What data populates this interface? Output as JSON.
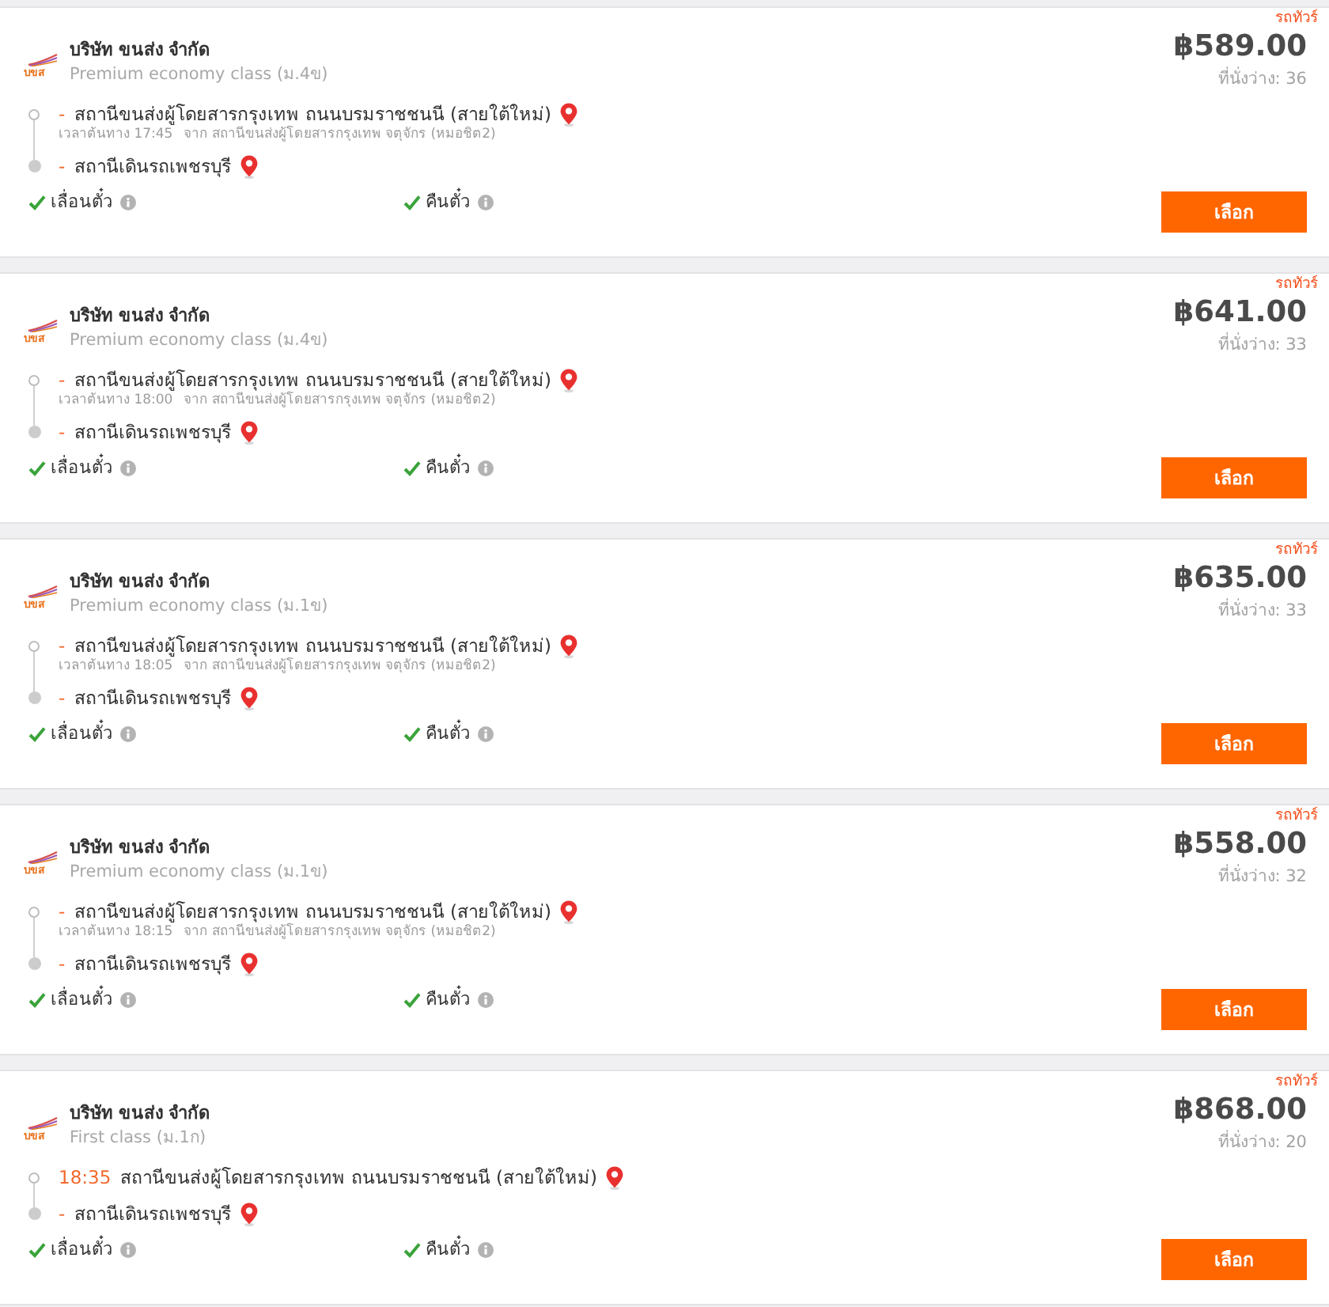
{
  "trips": [
    {
      "tag": "รถทัวร์",
      "logo_text": "บขส",
      "company": "บริษัท ขนส่ง จำกัด",
      "service_class": "Premium economy class (ม.4ข)",
      "price": "฿589.00",
      "seats": "ที่นั่งว่าง: 36",
      "departure": {
        "marker": "-",
        "station": "สถานีขนส่งผู้โดยสารกรุงเทพ ถนนบรมราชชนนี (สายใต้ใหม่)"
      },
      "origin_note": {
        "time": "เวลาต้นทาง 17:45",
        "from": "จาก สถานีขนส่งผู้โดยสารกรุงเทพ จตุจักร (หมอชิต2)"
      },
      "arrival": {
        "marker": "-",
        "station": "สถานีเดินรถเพชรบุรี"
      },
      "policies": [
        {
          "label": "เลื่อนตั๋ว",
          "allowed": true
        },
        {
          "label": "คืนตั๋ว",
          "allowed": true
        }
      ],
      "button": "เลือก"
    },
    {
      "tag": "รถทัวร์",
      "logo_text": "บขส",
      "company": "บริษัท ขนส่ง จำกัด",
      "service_class": "Premium economy class (ม.4ข)",
      "price": "฿641.00",
      "seats": "ที่นั่งว่าง: 33",
      "departure": {
        "marker": "-",
        "station": "สถานีขนส่งผู้โดยสารกรุงเทพ ถนนบรมราชชนนี (สายใต้ใหม่)"
      },
      "origin_note": {
        "time": "เวลาต้นทาง 18:00",
        "from": "จาก สถานีขนส่งผู้โดยสารกรุงเทพ จตุจักร (หมอชิต2)"
      },
      "arrival": {
        "marker": "-",
        "station": "สถานีเดินรถเพชรบุรี"
      },
      "policies": [
        {
          "label": "เลื่อนตั๋ว",
          "allowed": true
        },
        {
          "label": "คืนตั๋ว",
          "allowed": true
        }
      ],
      "button": "เลือก"
    },
    {
      "tag": "รถทัวร์",
      "logo_text": "บขส",
      "company": "บริษัท ขนส่ง จำกัด",
      "service_class": "Premium economy class (ม.1ข)",
      "price": "฿635.00",
      "seats": "ที่นั่งว่าง: 33",
      "departure": {
        "marker": "-",
        "station": "สถานีขนส่งผู้โดยสารกรุงเทพ ถนนบรมราชชนนี (สายใต้ใหม่)"
      },
      "origin_note": {
        "time": "เวลาต้นทาง 18:05",
        "from": "จาก สถานีขนส่งผู้โดยสารกรุงเทพ จตุจักร (หมอชิต2)"
      },
      "arrival": {
        "marker": "-",
        "station": "สถานีเดินรถเพชรบุรี"
      },
      "policies": [
        {
          "label": "เลื่อนตั๋ว",
          "allowed": true
        },
        {
          "label": "คืนตั๋ว",
          "allowed": true
        }
      ],
      "button": "เลือก"
    },
    {
      "tag": "รถทัวร์",
      "logo_text": "บขส",
      "company": "บริษัท ขนส่ง จำกัด",
      "service_class": "Premium economy class (ม.1ข)",
      "price": "฿558.00",
      "seats": "ที่นั่งว่าง: 32",
      "departure": {
        "marker": "-",
        "station": "สถานีขนส่งผู้โดยสารกรุงเทพ ถนนบรมราชชนนี (สายใต้ใหม่)"
      },
      "origin_note": {
        "time": "เวลาต้นทาง 18:15",
        "from": "จาก สถานีขนส่งผู้โดยสารกรุงเทพ จตุจักร (หมอชิต2)"
      },
      "arrival": {
        "marker": "-",
        "station": "สถานีเดินรถเพชรบุรี"
      },
      "policies": [
        {
          "label": "เลื่อนตั๋ว",
          "allowed": true
        },
        {
          "label": "คืนตั๋ว",
          "allowed": true
        }
      ],
      "button": "เลือก"
    },
    {
      "tag": "รถทัวร์",
      "logo_text": "บขส",
      "company": "บริษัท ขนส่ง จำกัด",
      "service_class": "First class (ม.1ก)",
      "price": "฿868.00",
      "seats": "ที่นั่งว่าง: 20",
      "departure": {
        "marker": "18:35",
        "station": "สถานีขนส่งผู้โดยสารกรุงเทพ ถนนบรมราชชนนี (สายใต้ใหม่)"
      },
      "arrival": {
        "marker": "-",
        "station": "สถานีเดินรถเพชรบุรี"
      },
      "policies": [
        {
          "label": "เลื่อนตั๋ว",
          "allowed": true
        },
        {
          "label": "คืนตั๋ว",
          "allowed": true
        }
      ],
      "button": "เลือก"
    }
  ]
}
